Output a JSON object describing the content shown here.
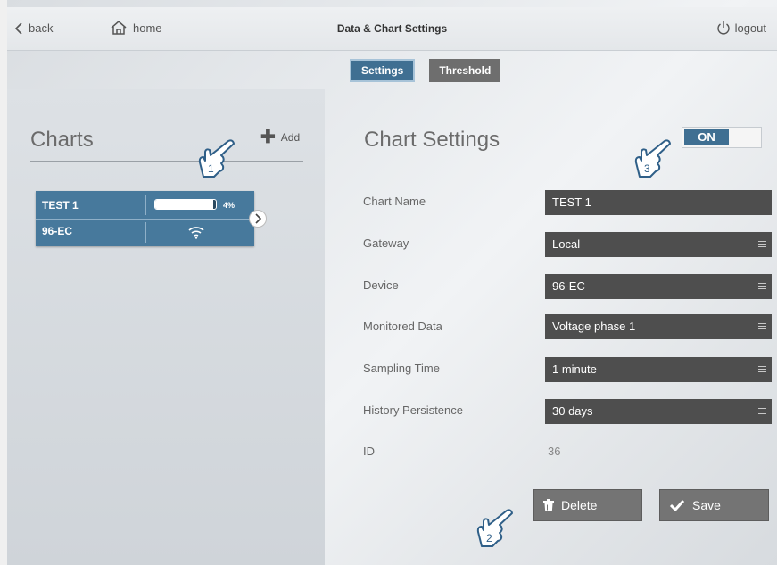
{
  "topbar": {
    "back_label": "back",
    "home_label": "home",
    "title": "Data & Chart Settings",
    "logout_label": "logout"
  },
  "tabs": [
    {
      "label": "Settings",
      "active": true
    },
    {
      "label": "Threshold",
      "active": false
    }
  ],
  "charts_panel": {
    "title": "Charts",
    "add_label": "Add",
    "items": [
      {
        "name": "TEST 1",
        "device": "96-EC",
        "progress_percent": 4,
        "progress_label": "4%",
        "status_icon": "wifi-icon"
      }
    ]
  },
  "chart_settings": {
    "title": "Chart Settings",
    "toggle_label": "ON",
    "fields": [
      {
        "label": "Chart Name",
        "value": "TEST 1",
        "dropdown": false
      },
      {
        "label": "Gateway",
        "value": "Local",
        "dropdown": true
      },
      {
        "label": "Device",
        "value": "96-EC",
        "dropdown": true
      },
      {
        "label": "Monitored Data",
        "value": "Voltage phase 1",
        "dropdown": true
      },
      {
        "label": "Sampling Time",
        "value": "1 minute",
        "dropdown": true
      },
      {
        "label": "History Persistence",
        "value": "30 days",
        "dropdown": true
      }
    ],
    "id_label": "ID",
    "id_value": "36",
    "delete_label": "Delete",
    "save_label": "Save"
  },
  "callouts": [
    "1",
    "2",
    "3"
  ],
  "colors": {
    "accent": "#3f6f92",
    "card": "#47799c",
    "field": "#4e4e4e",
    "button": "#747474"
  }
}
